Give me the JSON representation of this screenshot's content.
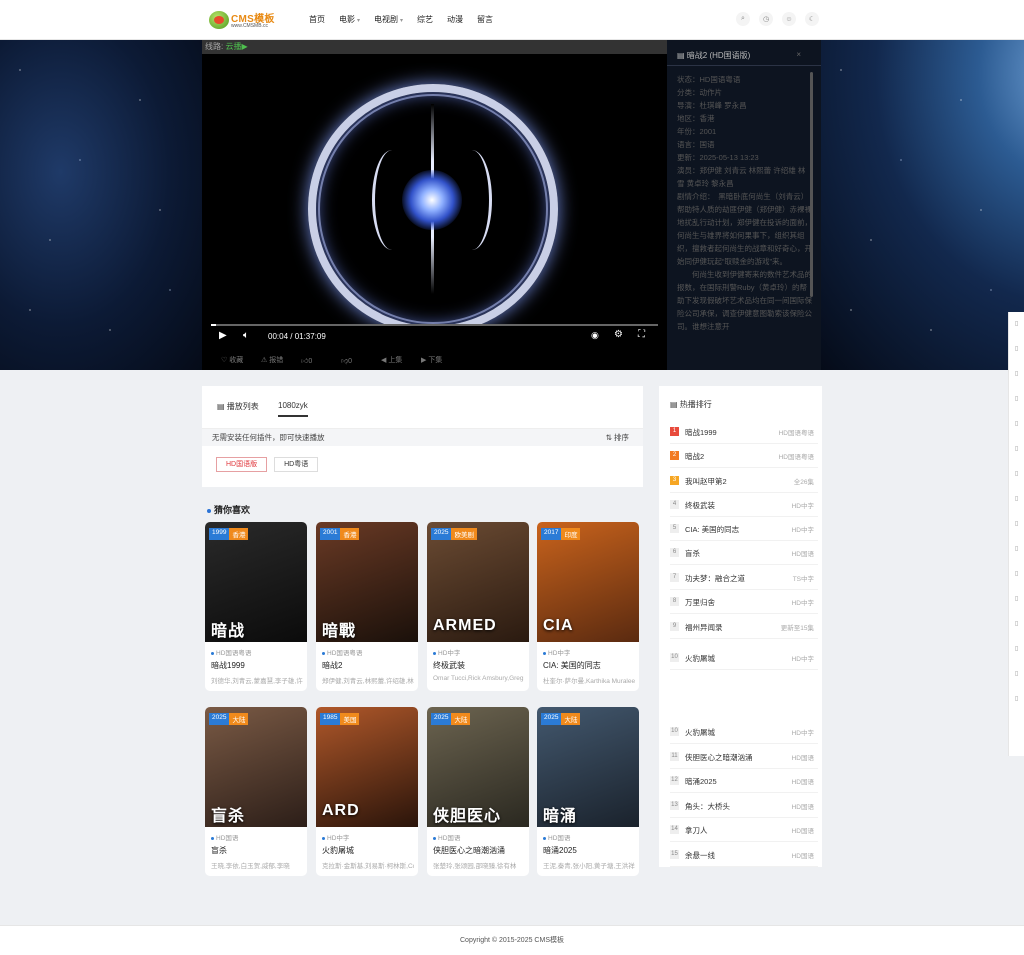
{
  "header": {
    "logo_text": "CMS模板",
    "logo_url": "www.CMSMB.cc",
    "nav": [
      {
        "label": "首页",
        "caret": false
      },
      {
        "label": "电影",
        "caret": true
      },
      {
        "label": "电视剧",
        "caret": true
      },
      {
        "label": "综艺",
        "caret": false
      },
      {
        "label": "动漫",
        "caret": false
      },
      {
        "label": "留言",
        "caret": false
      }
    ],
    "icons": [
      "search-icon",
      "history-icon",
      "user-icon",
      "moon-icon"
    ]
  },
  "player": {
    "line_label": "线路:",
    "line_value": "云播▶",
    "time": "00:04 / 01:37:09",
    "progress_fraction": 0.002,
    "actions": [
      "收藏",
      "报错",
      "0",
      "0",
      "上集",
      "下集"
    ]
  },
  "info": {
    "title": "暗战2 (HD国语版)",
    "close": "×",
    "lines": [
      "状态：HD国语粤语",
      "分类：动作片",
      "导演：杜琪峰  罗永昌",
      "地区：香港",
      "年份：2001",
      "语言：国语",
      "更新：2025-05-13 13:23",
      "演员：郑伊健  刘青云  林熙蕾  许绍雄  林雪  黄卓玲  黎永昌",
      "剧情介绍：　黑暗卧底何尚生（刘青云）帮助特人质的劫匪伊健（郑伊健）赤裸裸地扰乱行动计划，郑伊健在投诉的面前，何尚生与雄界将如何果事下，组织其组织，擅救者起何尚生的战章和好奇心，开始同伊健玩起“取赎金的游戏”来。",
      "　　何尚生收到伊健寄来的数件艺术品的报数，在国际刑警Ruby（黄卓玲）的帮助下发现假破坏艺术品均在同一间国际保险公司承保，调查伊健意图勒索该保险公司。谁想注意开"
    ]
  },
  "playlist": {
    "tab1": "播放列表",
    "tab2": "1080zyk",
    "note": "无需安装任何插件，即可快速播放",
    "sort": "排序",
    "episodes": [
      {
        "label": "HD国语版",
        "active": true
      },
      {
        "label": "HD粤语",
        "active": false
      }
    ]
  },
  "guess": {
    "title": "猜你喜欢",
    "items": [
      {
        "year": "1999",
        "type": "香港",
        "quality": "HD国语粤语",
        "name": "暗战1999",
        "actors": "刘德华,刘青云,蒙嘉慧,李子雄,许",
        "poster_text": "暗战",
        "c1": "#2a2a2a",
        "c2": "#0b0b0b"
      },
      {
        "year": "2001",
        "type": "香港",
        "quality": "HD国语粤语",
        "name": "暗战2",
        "actors": "郑伊健,刘青云,林熙蕾,许绍雄,林",
        "poster_text": "暗戰",
        "c1": "#6a3a25",
        "c2": "#1a100a"
      },
      {
        "year": "2025",
        "type": "欧美剧",
        "quality": "HD中字",
        "name": "终极武装",
        "actors": "Omar Tucci,Rick Amsbury,Greg",
        "poster_text": "ARMED",
        "c1": "#6b4b33",
        "c2": "#2a1a10"
      },
      {
        "year": "2017",
        "type": "印度",
        "quality": "HD中字",
        "name": "CIA: 美国的同志",
        "actors": "杜奎尔·萨尔曼,Karthika Muraleedharan",
        "poster_text": "CIA",
        "c1": "#c9631c",
        "c2": "#5a2a10"
      },
      {
        "year": "2025",
        "type": "大陆",
        "quality": "HD国语",
        "name": "盲杀",
        "actors": "王晓,李依,白玉贺,威郁,李晓",
        "poster_text": "盲杀",
        "c1": "#7a5a45",
        "c2": "#2c1e18"
      },
      {
        "year": "1985",
        "type": "美国",
        "quality": "HD中字",
        "name": "火豹屠城",
        "actors": "克拉斯·金斯基,刘易斯·柯林斯,Col",
        "poster_text": "ARD",
        "c1": "#b0582a",
        "c2": "#2a140a"
      },
      {
        "year": "2025",
        "type": "大陆",
        "quality": "HD国语",
        "name": "侠胆医心之暗潮汹涌",
        "actors": "张楚玲,张颂园,邵晓臻,徐有林",
        "poster_text": "侠胆医心",
        "c1": "#6c6450",
        "c2": "#2a2820"
      },
      {
        "year": "2025",
        "type": "大陆",
        "quality": "HD国语",
        "name": "暗涌2025",
        "actors": "王泥,秦青,张小阳,黄子塘,王洪祥",
        "poster_text": "暗涌",
        "c1": "#43586e",
        "c2": "#1a222c"
      }
    ]
  },
  "rank": {
    "title": "热播排行",
    "items": [
      {
        "n": "1",
        "name": "暗战1999",
        "sub": "HD国语粤语"
      },
      {
        "n": "2",
        "name": "暗战2",
        "sub": "HD国语粤语"
      },
      {
        "n": "3",
        "name": "我叫赵甲第2",
        "sub": "全26集"
      },
      {
        "n": "4",
        "name": "终极武装",
        "sub": "HD中字"
      },
      {
        "n": "5",
        "name": "CIA: 美国的同志",
        "sub": "HD中字"
      },
      {
        "n": "6",
        "name": "盲杀",
        "sub": "HD国语"
      },
      {
        "n": "7",
        "name": "功夫梦：融合之道",
        "sub": "TS中字"
      },
      {
        "n": "8",
        "name": "万里归舍",
        "sub": "HD中字"
      },
      {
        "n": "9",
        "name": "福州异闻录",
        "sub": "更新至15集"
      },
      {
        "n": "10",
        "name": "火豹屠城",
        "sub": "HD中字"
      },
      {
        "n": "10",
        "name": "火豹屠城",
        "sub": "HD中字"
      },
      {
        "n": "11",
        "name": "侠胆医心之暗潮汹涌",
        "sub": "HD国语"
      },
      {
        "n": "12",
        "name": "暗涌2025",
        "sub": "HD国语"
      },
      {
        "n": "13",
        "name": "角头：大桥头",
        "sub": "HD国语"
      },
      {
        "n": "14",
        "name": "拿刀人",
        "sub": "HD国语"
      },
      {
        "n": "15",
        "name": "余悬一线",
        "sub": "HD国语"
      }
    ]
  },
  "footer": {
    "copyright": "Copyright © 2015-2025 CMS模板"
  }
}
